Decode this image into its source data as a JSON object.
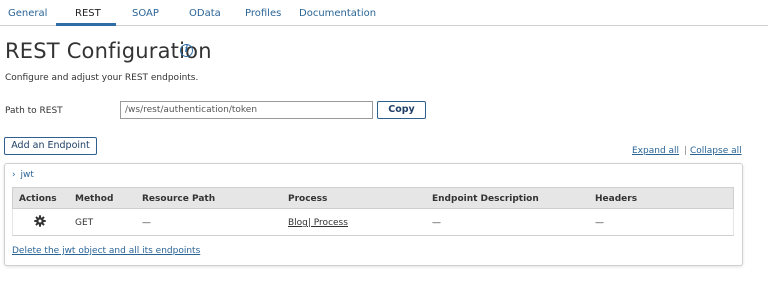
{
  "tabs": [
    {
      "label": "General"
    },
    {
      "label": "REST"
    },
    {
      "label": "SOAP"
    },
    {
      "label": "OData"
    },
    {
      "label": "Profiles"
    },
    {
      "label": "Documentation"
    }
  ],
  "active_tab": "REST",
  "page": {
    "title": "REST Configuration",
    "subtitle": "Configure and adjust your REST endpoints."
  },
  "path": {
    "label": "Path to REST",
    "value": "/ws/rest/authentication/token",
    "copy_label": "Copy"
  },
  "add_endpoint_label": "Add an Endpoint",
  "expand_all_label": "Expand all",
  "separator": "|",
  "collapse_all_label": "Collapse all",
  "group": {
    "toggle_icon": "chevron-right",
    "name": "jwt",
    "columns": [
      "Actions",
      "Method",
      "Resource Path",
      "Process",
      "Endpoint Description",
      "Headers"
    ],
    "rows": [
      {
        "action_icon": "gear",
        "method": "GET",
        "resource_path": "—",
        "process": "Blog| Process",
        "description": "—",
        "headers": "—"
      }
    ],
    "delete_label": "Delete the jwt object and all its endpoints"
  },
  "colors": {
    "accent": "#2f6da6",
    "link": "#2a6496",
    "header_bg": "#e6e6e6"
  }
}
